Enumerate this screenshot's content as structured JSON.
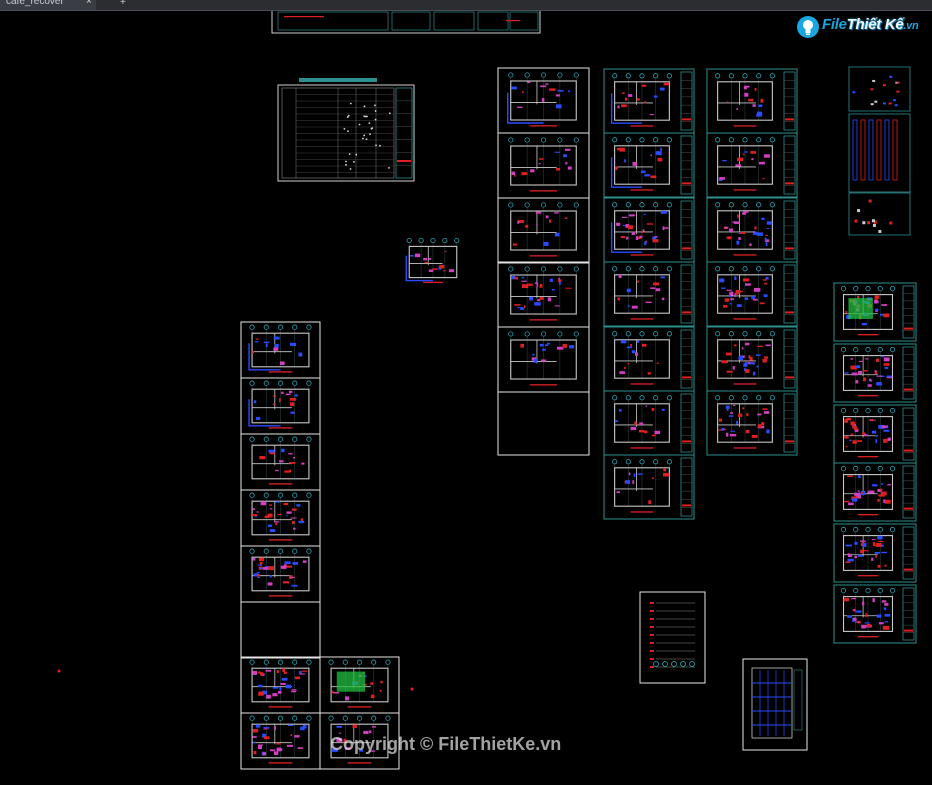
{
  "window": {
    "tab_title": "cafe_recover",
    "tab_close": "×",
    "tab_add": "+"
  },
  "drawing": {
    "background": "#000000",
    "sheet_frame_color": "#e6e6e6",
    "title_block_color": "#2e8f8f",
    "wall_color": "#c9c9c9",
    "accent_red": "#e02020",
    "accent_blue": "#2a4cff",
    "accent_cyan": "#2fb8c8",
    "accent_green": "#22c040",
    "accent_magenta": "#d040c0"
  },
  "logo": {
    "icon": "light-bulb-icon",
    "word_file": "File",
    "word_thietke": "Thiết Kế",
    "word_tld": ".vn"
  },
  "watermark": {
    "text": "Copyright © FileThietKe.vn"
  }
}
